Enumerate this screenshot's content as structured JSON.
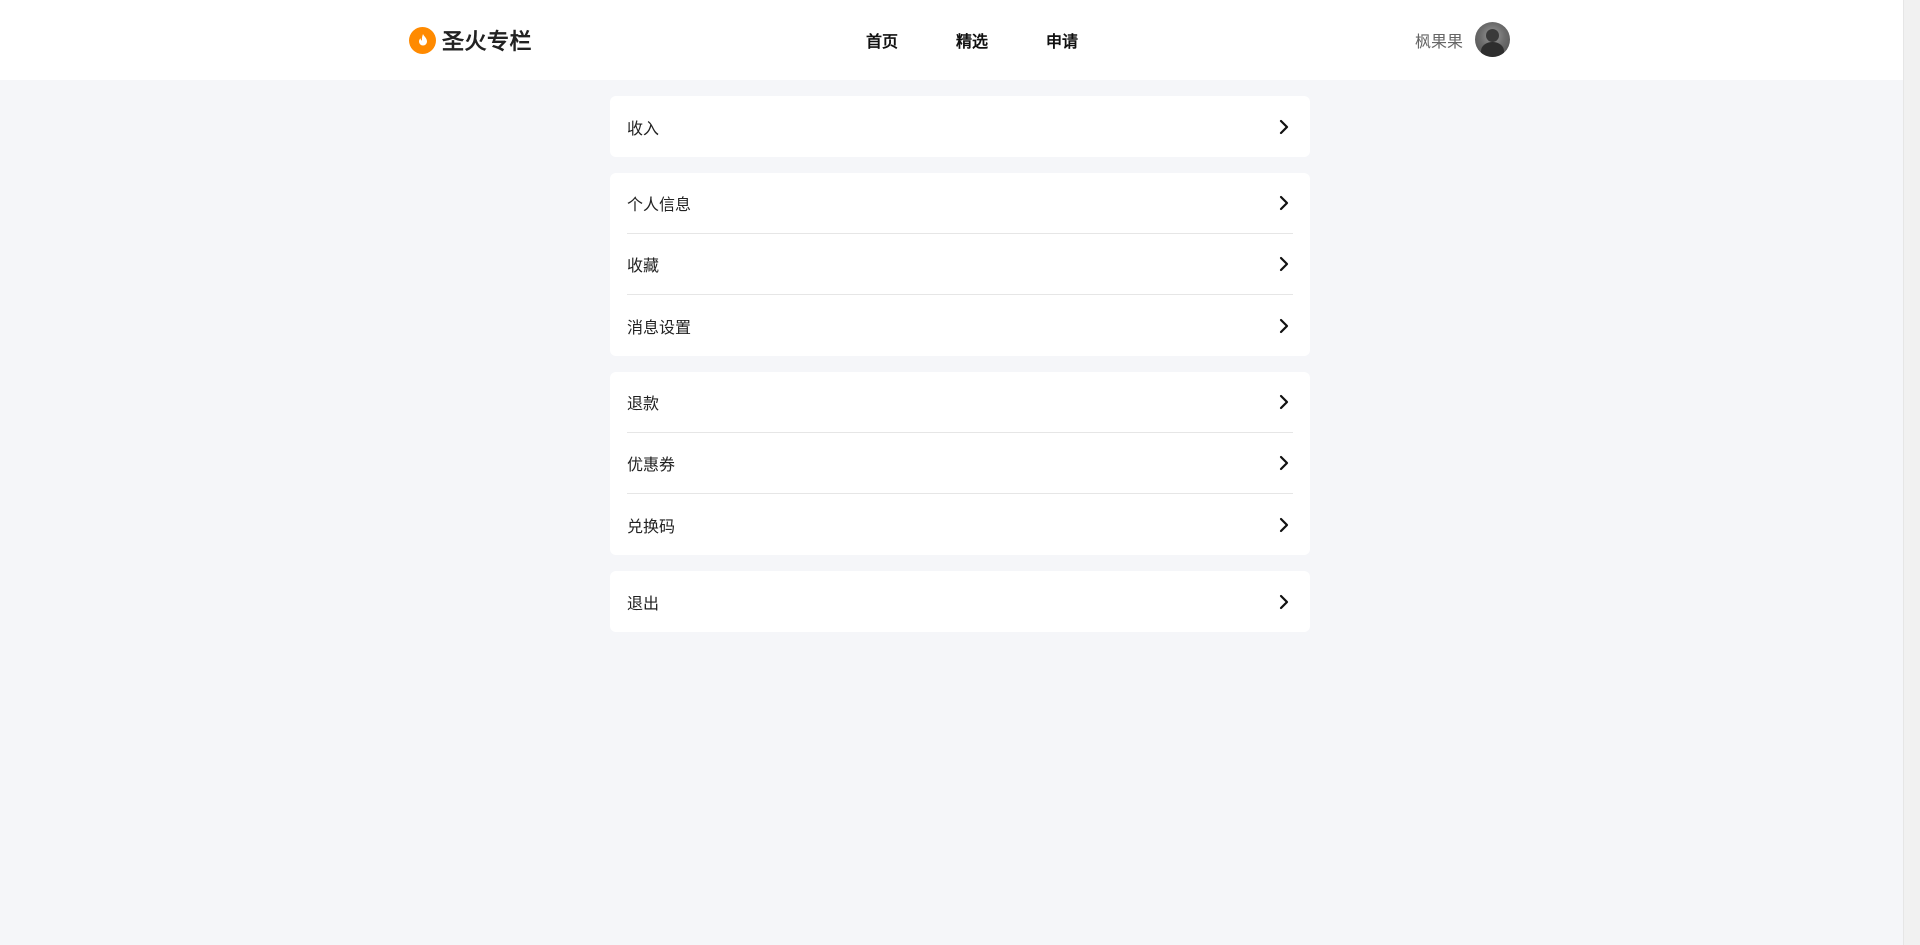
{
  "header": {
    "logo_text": "圣火专栏",
    "logo_icon": "flame-icon",
    "nav": [
      {
        "label": "首页"
      },
      {
        "label": "精选"
      },
      {
        "label": "申请"
      }
    ],
    "username": "枫果果"
  },
  "menu": {
    "groups": [
      {
        "items": [
          {
            "label": "收入"
          }
        ]
      },
      {
        "items": [
          {
            "label": "个人信息"
          },
          {
            "label": "收藏"
          },
          {
            "label": "消息设置"
          }
        ]
      },
      {
        "items": [
          {
            "label": "退款"
          },
          {
            "label": "优惠券"
          },
          {
            "label": "兑换码"
          }
        ]
      },
      {
        "items": [
          {
            "label": "退出"
          }
        ]
      }
    ]
  },
  "colors": {
    "accent": "#ff8a00",
    "background": "#f5f6f9",
    "card": "#ffffff",
    "divider": "#e6e6e6"
  }
}
